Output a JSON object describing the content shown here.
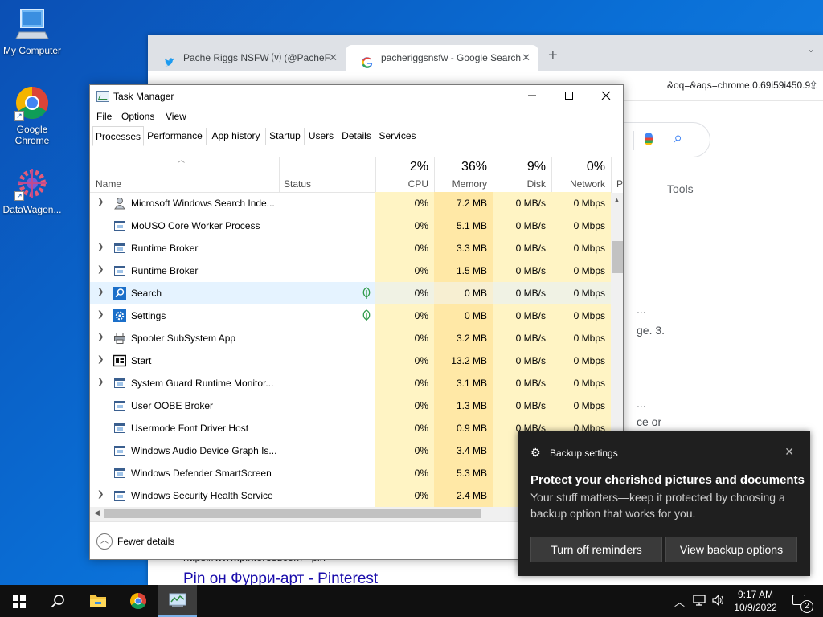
{
  "desktop": {
    "icons": [
      {
        "label": "My Computer",
        "icon": "computer-icon"
      },
      {
        "label": "Google Chrome",
        "icon": "chrome-icon"
      },
      {
        "label": "DataWagon...",
        "icon": "datawagon-icon"
      }
    ]
  },
  "browser": {
    "tabs": [
      {
        "label": "Pache Riggs NSFW ⒱ (@PacheF",
        "icon": "twitter-icon",
        "active": false
      },
      {
        "label": "pacheriggsnsfw - Google Search",
        "icon": "google-icon",
        "active": true
      }
    ],
    "new_tab_glyph": "+",
    "url_fragment": "&oq=&aqs=chrome.0.69i59i450.9...",
    "tools_label": "Tools",
    "fragments": [
      "...",
      "ge. 3.",
      "...",
      "ce or"
    ],
    "result_url": "https://www.pinterest.com › pin",
    "result_title": "Pin он Фурри-арт - Pinterest"
  },
  "task_manager": {
    "title": "Task Manager",
    "menu": [
      "File",
      "Options",
      "View"
    ],
    "tabs": [
      "Processes",
      "Performance",
      "App history",
      "Startup",
      "Users",
      "Details",
      "Services"
    ],
    "active_tab": "Processes",
    "columns": {
      "name": "Name",
      "status": "Status",
      "cpu": {
        "pct": "2%",
        "label": "CPU"
      },
      "memory": {
        "pct": "36%",
        "label": "Memory"
      },
      "disk": {
        "pct": "9%",
        "label": "Disk"
      },
      "network": {
        "pct": "0%",
        "label": "Network"
      },
      "power_truncated": "P"
    },
    "rows": [
      {
        "name": "Microsoft Windows Search Inde...",
        "expandable": true,
        "icon": "search-indexer-icon",
        "leaf": false,
        "cpu": "0%",
        "memory": "7.2 MB",
        "disk": "0 MB/s",
        "network": "0 Mbps"
      },
      {
        "name": "MoUSO Core Worker Process",
        "expandable": false,
        "icon": "process-icon",
        "leaf": false,
        "cpu": "0%",
        "memory": "5.1 MB",
        "disk": "0 MB/s",
        "network": "0 Mbps"
      },
      {
        "name": "Runtime Broker",
        "expandable": true,
        "icon": "process-icon",
        "leaf": false,
        "cpu": "0%",
        "memory": "3.3 MB",
        "disk": "0 MB/s",
        "network": "0 Mbps"
      },
      {
        "name": "Runtime Broker",
        "expandable": true,
        "icon": "process-icon",
        "leaf": false,
        "cpu": "0%",
        "memory": "1.5 MB",
        "disk": "0 MB/s",
        "network": "0 Mbps"
      },
      {
        "name": "Search",
        "expandable": true,
        "icon": "search-app-icon",
        "leaf": true,
        "cpu": "0%",
        "memory": "0 MB",
        "disk": "0 MB/s",
        "network": "0 Mbps",
        "hover": true
      },
      {
        "name": "Settings",
        "expandable": true,
        "icon": "settings-gear-icon",
        "leaf": true,
        "cpu": "0%",
        "memory": "0 MB",
        "disk": "0 MB/s",
        "network": "0 Mbps"
      },
      {
        "name": "Spooler SubSystem App",
        "expandable": true,
        "icon": "printer-icon",
        "leaf": false,
        "cpu": "0%",
        "memory": "3.2 MB",
        "disk": "0 MB/s",
        "network": "0 Mbps"
      },
      {
        "name": "Start",
        "expandable": true,
        "icon": "start-icon",
        "leaf": false,
        "cpu": "0%",
        "memory": "13.2 MB",
        "disk": "0 MB/s",
        "network": "0 Mbps"
      },
      {
        "name": "System Guard Runtime Monitor...",
        "expandable": true,
        "icon": "process-icon",
        "leaf": false,
        "cpu": "0%",
        "memory": "3.1 MB",
        "disk": "0 MB/s",
        "network": "0 Mbps"
      },
      {
        "name": "User OOBE Broker",
        "expandable": false,
        "icon": "process-icon",
        "leaf": false,
        "cpu": "0%",
        "memory": "1.3 MB",
        "disk": "0 MB/s",
        "network": "0 Mbps"
      },
      {
        "name": "Usermode Font Driver Host",
        "expandable": false,
        "icon": "process-icon",
        "leaf": false,
        "cpu": "0%",
        "memory": "0.9 MB",
        "disk": "0 MB/s",
        "network": "0 Mbps"
      },
      {
        "name": "Windows Audio Device Graph Is...",
        "expandable": false,
        "icon": "process-icon",
        "leaf": false,
        "cpu": "0%",
        "memory": "3.4 MB",
        "disk": "",
        "network": ""
      },
      {
        "name": "Windows Defender SmartScreen",
        "expandable": false,
        "icon": "process-icon",
        "leaf": false,
        "cpu": "0%",
        "memory": "5.3 MB",
        "disk": "",
        "network": ""
      },
      {
        "name": "Windows Security Health Service",
        "expandable": true,
        "icon": "process-icon",
        "leaf": false,
        "cpu": "0%",
        "memory": "2.4 MB",
        "disk": "",
        "network": ""
      }
    ],
    "footer": {
      "fewer_details": "Fewer details"
    }
  },
  "toast": {
    "app": "Backup settings",
    "heading": "Protect your cherished pictures and documents",
    "body": "Your stuff matters—keep it protected by choosing a backup option that works for you.",
    "buttons": [
      "Turn off reminders",
      "View backup options"
    ]
  },
  "taskbar": {
    "items": [
      "start-icon",
      "search-icon",
      "file-explorer-icon",
      "chrome-icon",
      "task-manager-icon"
    ],
    "active": "task-manager-icon",
    "time": "9:17 AM",
    "date": "10/9/2022",
    "notification_count": "2"
  },
  "colors": {
    "cpu_cell": "#fff4c4",
    "memory_cell": "#ffe8a6",
    "hover_row": "#e5f3ff",
    "toast_bg": "#1f1f1f",
    "taskbar_bg": "#101010"
  }
}
